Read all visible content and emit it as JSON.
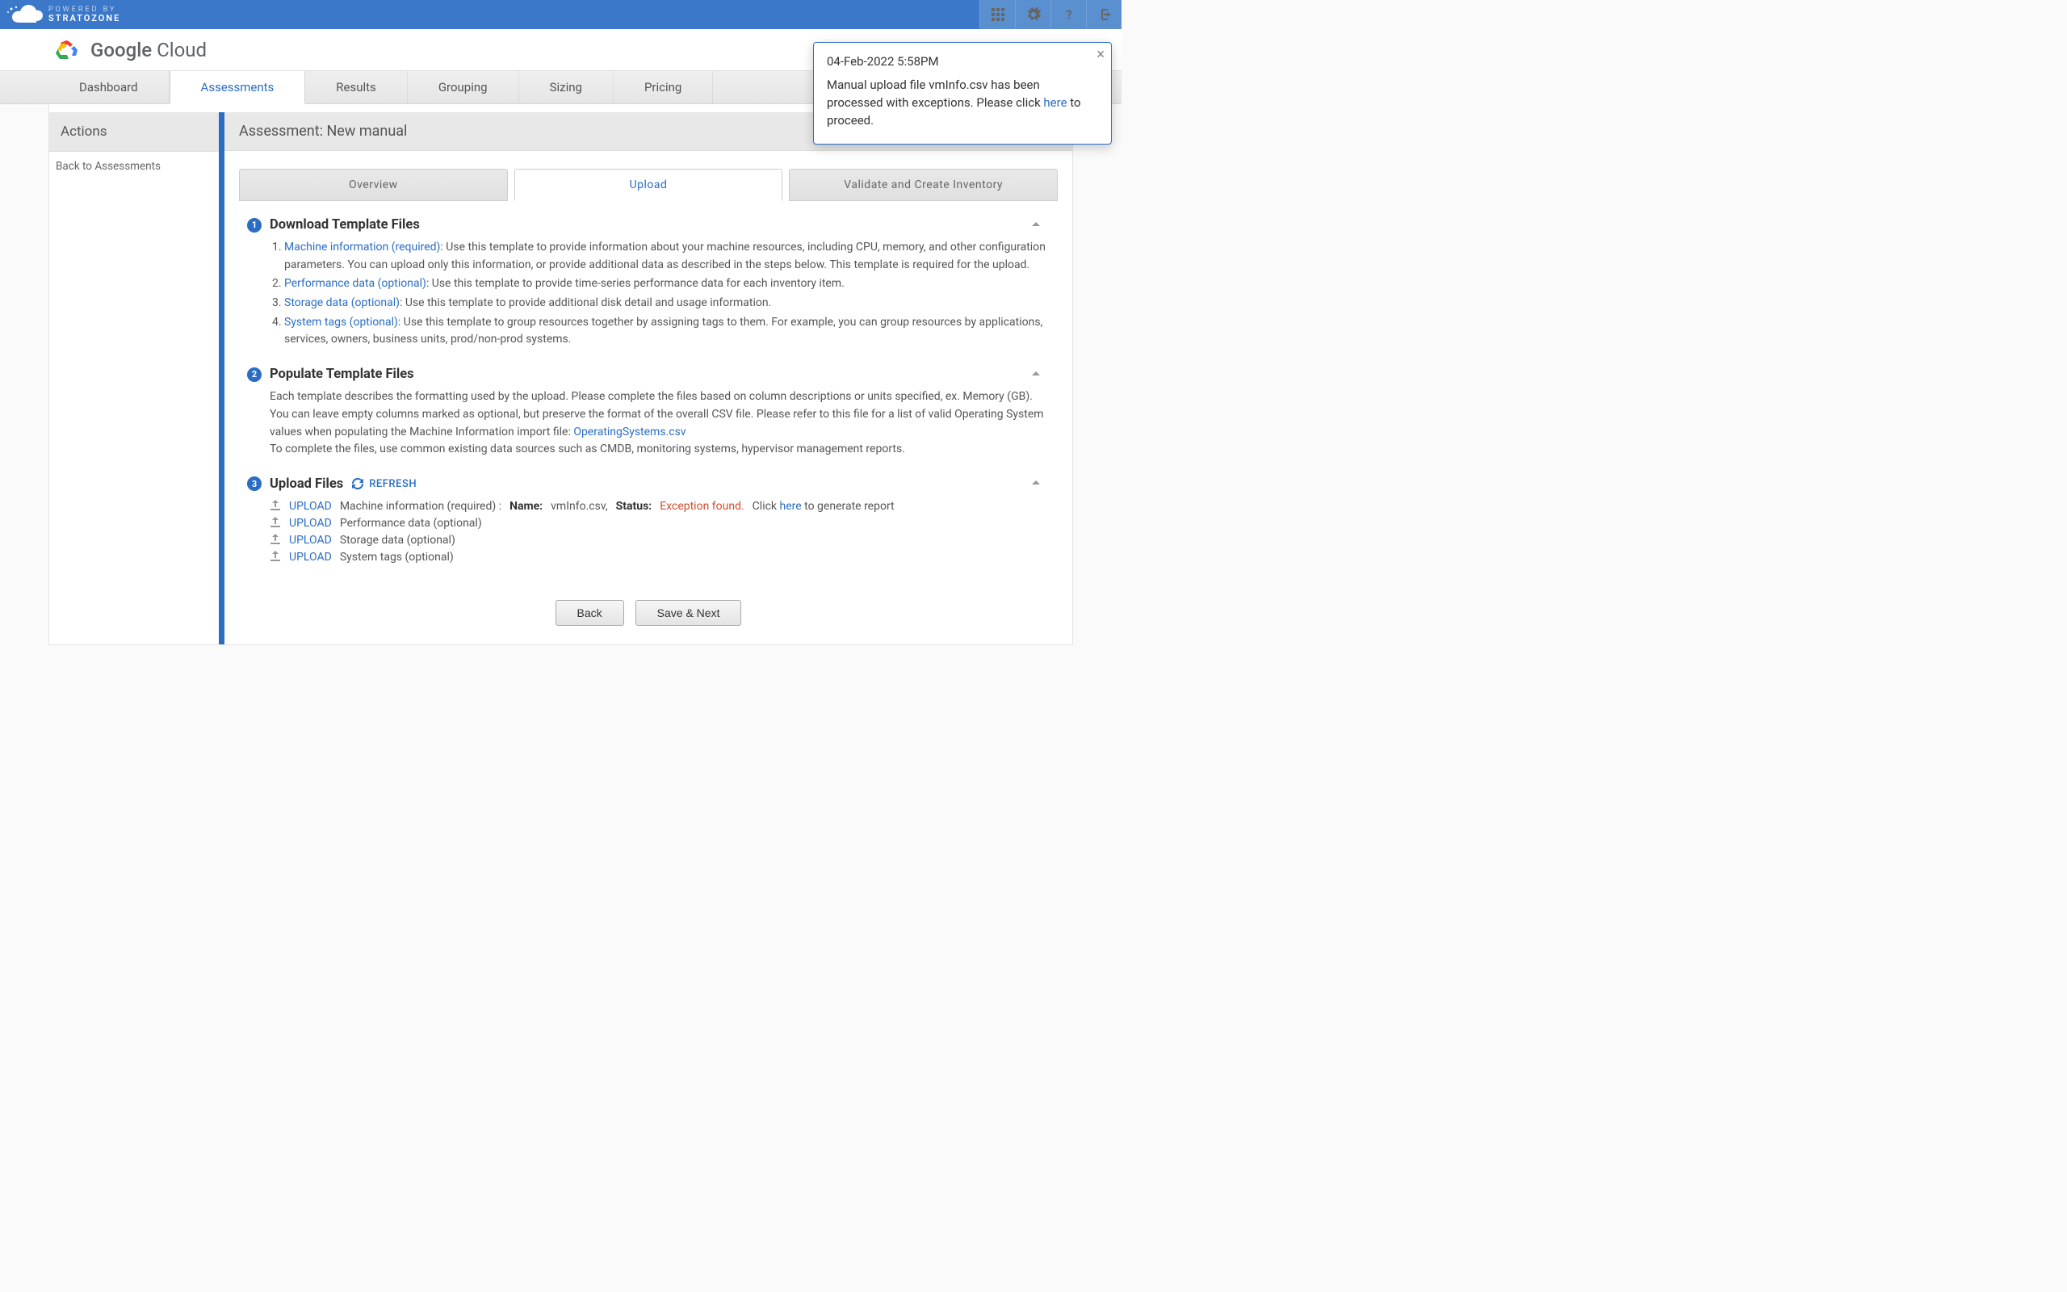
{
  "brand": {
    "line1": "POWERED BY",
    "line2": "STRATOZONE"
  },
  "gcloud": {
    "bold": "Google",
    "light": " Cloud"
  },
  "mainnav": [
    "Dashboard",
    "Assessments",
    "Results",
    "Grouping",
    "Sizing",
    "Pricing"
  ],
  "mainnav_active": 1,
  "sidebar": {
    "header": "Actions",
    "back": "Back to Assessments"
  },
  "content": {
    "title_prefix": "Assessment: ",
    "title_name": "New manual"
  },
  "subtabs": [
    "Overview",
    "Upload",
    "Validate and Create Inventory"
  ],
  "subtab_active": 1,
  "step1": {
    "title": "Download Template Files",
    "items": [
      {
        "link": "Machine information (required)",
        "text": ": Use this template to provide information about your machine resources, including CPU, memory, and other configuration parameters. You can upload only this information, or provide additional data as described in the steps below. This template is required for the upload."
      },
      {
        "link": "Performance data (optional)",
        "text": ": Use this template to provide time-series performance data for each inventory item."
      },
      {
        "link": "Storage data (optional)",
        "text": ": Use this template to provide additional disk detail and usage information."
      },
      {
        "link": "System tags (optional)",
        "text": ": Use this template to group resources together by assigning tags to them. For example, you can group resources by applications, services, owners, business units, prod/non-prod systems."
      }
    ]
  },
  "step2": {
    "title": "Populate Template Files",
    "text1": "Each template describes the formatting used by the upload. Please complete the files based on column descriptions or units specified, ex. Memory (GB). You can leave empty columns marked as optional, but preserve the format of the overall CSV file. Please refer to this file for a list of valid Operating System values when populating the Machine Information import file: ",
    "file_link": "OperatingSystems.csv",
    "text2": "To complete the files, use common existing data sources such as CMDB, monitoring systems, hypervisor management reports."
  },
  "step3": {
    "title": "Upload Files",
    "refresh": "REFRESH",
    "upload_label": "UPLOAD",
    "rows": {
      "r1": {
        "label": "Machine information (required) :",
        "name_key": "Name:",
        "name_val": "vmInfo.csv,",
        "status_key": "Status:",
        "status_val": "Exception found.",
        "hint_pre": "Click ",
        "hint_link": "here",
        "hint_post": " to generate report"
      },
      "r2": {
        "label": "Performance data (optional)"
      },
      "r3": {
        "label": "Storage data (optional)"
      },
      "r4": {
        "label": "System tags (optional)"
      }
    }
  },
  "buttons": {
    "back": "Back",
    "next": "Save & Next"
  },
  "toast": {
    "time": "04-Feb-2022 5:58PM",
    "body_pre": "Manual upload file vmInfo.csv has been processed with exceptions. Please click ",
    "body_link": "here",
    "body_post": " to proceed."
  }
}
